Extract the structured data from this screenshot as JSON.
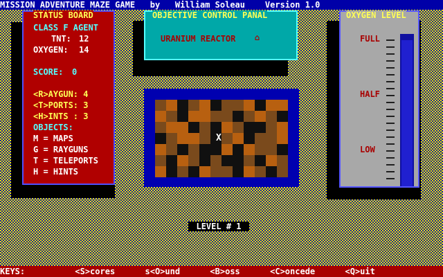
{
  "title_bar": "MISSION ADVENTURE MAZE GAME   by   William Soleau    Version 1.0",
  "status_board": {
    "header": "STATUS BOARD",
    "rank": "CLASS F AGENT",
    "tnt_label": "TNT:",
    "tnt_value": "12",
    "oxygen_label": "OXYGEN:",
    "oxygen_value": "14",
    "score_label": "SCORE:",
    "score_value": "0",
    "raygun": "<R>AYGUN: 4",
    "teleports": "<T>PORTS: 3",
    "hints": "<H>INTS : 3",
    "objects_header": "OBJECTS:",
    "objects": [
      "M = MAPS",
      "G = RAYGUNS",
      "T = TELEPORTS",
      "H = HINTS"
    ]
  },
  "objective": {
    "header": "OBJECTIVE CONTROL PANAL",
    "target": "URANIUM REACTOR",
    "symbol": "⌂"
  },
  "oxygen_meter": {
    "header": "OXYGEN LEVEL",
    "labels": [
      "FULL",
      "HALF",
      "LOW"
    ],
    "level": 0.96
  },
  "maze": {
    "player_symbol": "X"
  },
  "level_label": "LEVEL # 1",
  "keys_bar": "KEYS:          <S>cores      s<O>und      <B>oss      <C>oncede      <Q>uit",
  "colors": {
    "orange": "#b86010",
    "blue": "#0000a8",
    "red": "#a80000"
  }
}
